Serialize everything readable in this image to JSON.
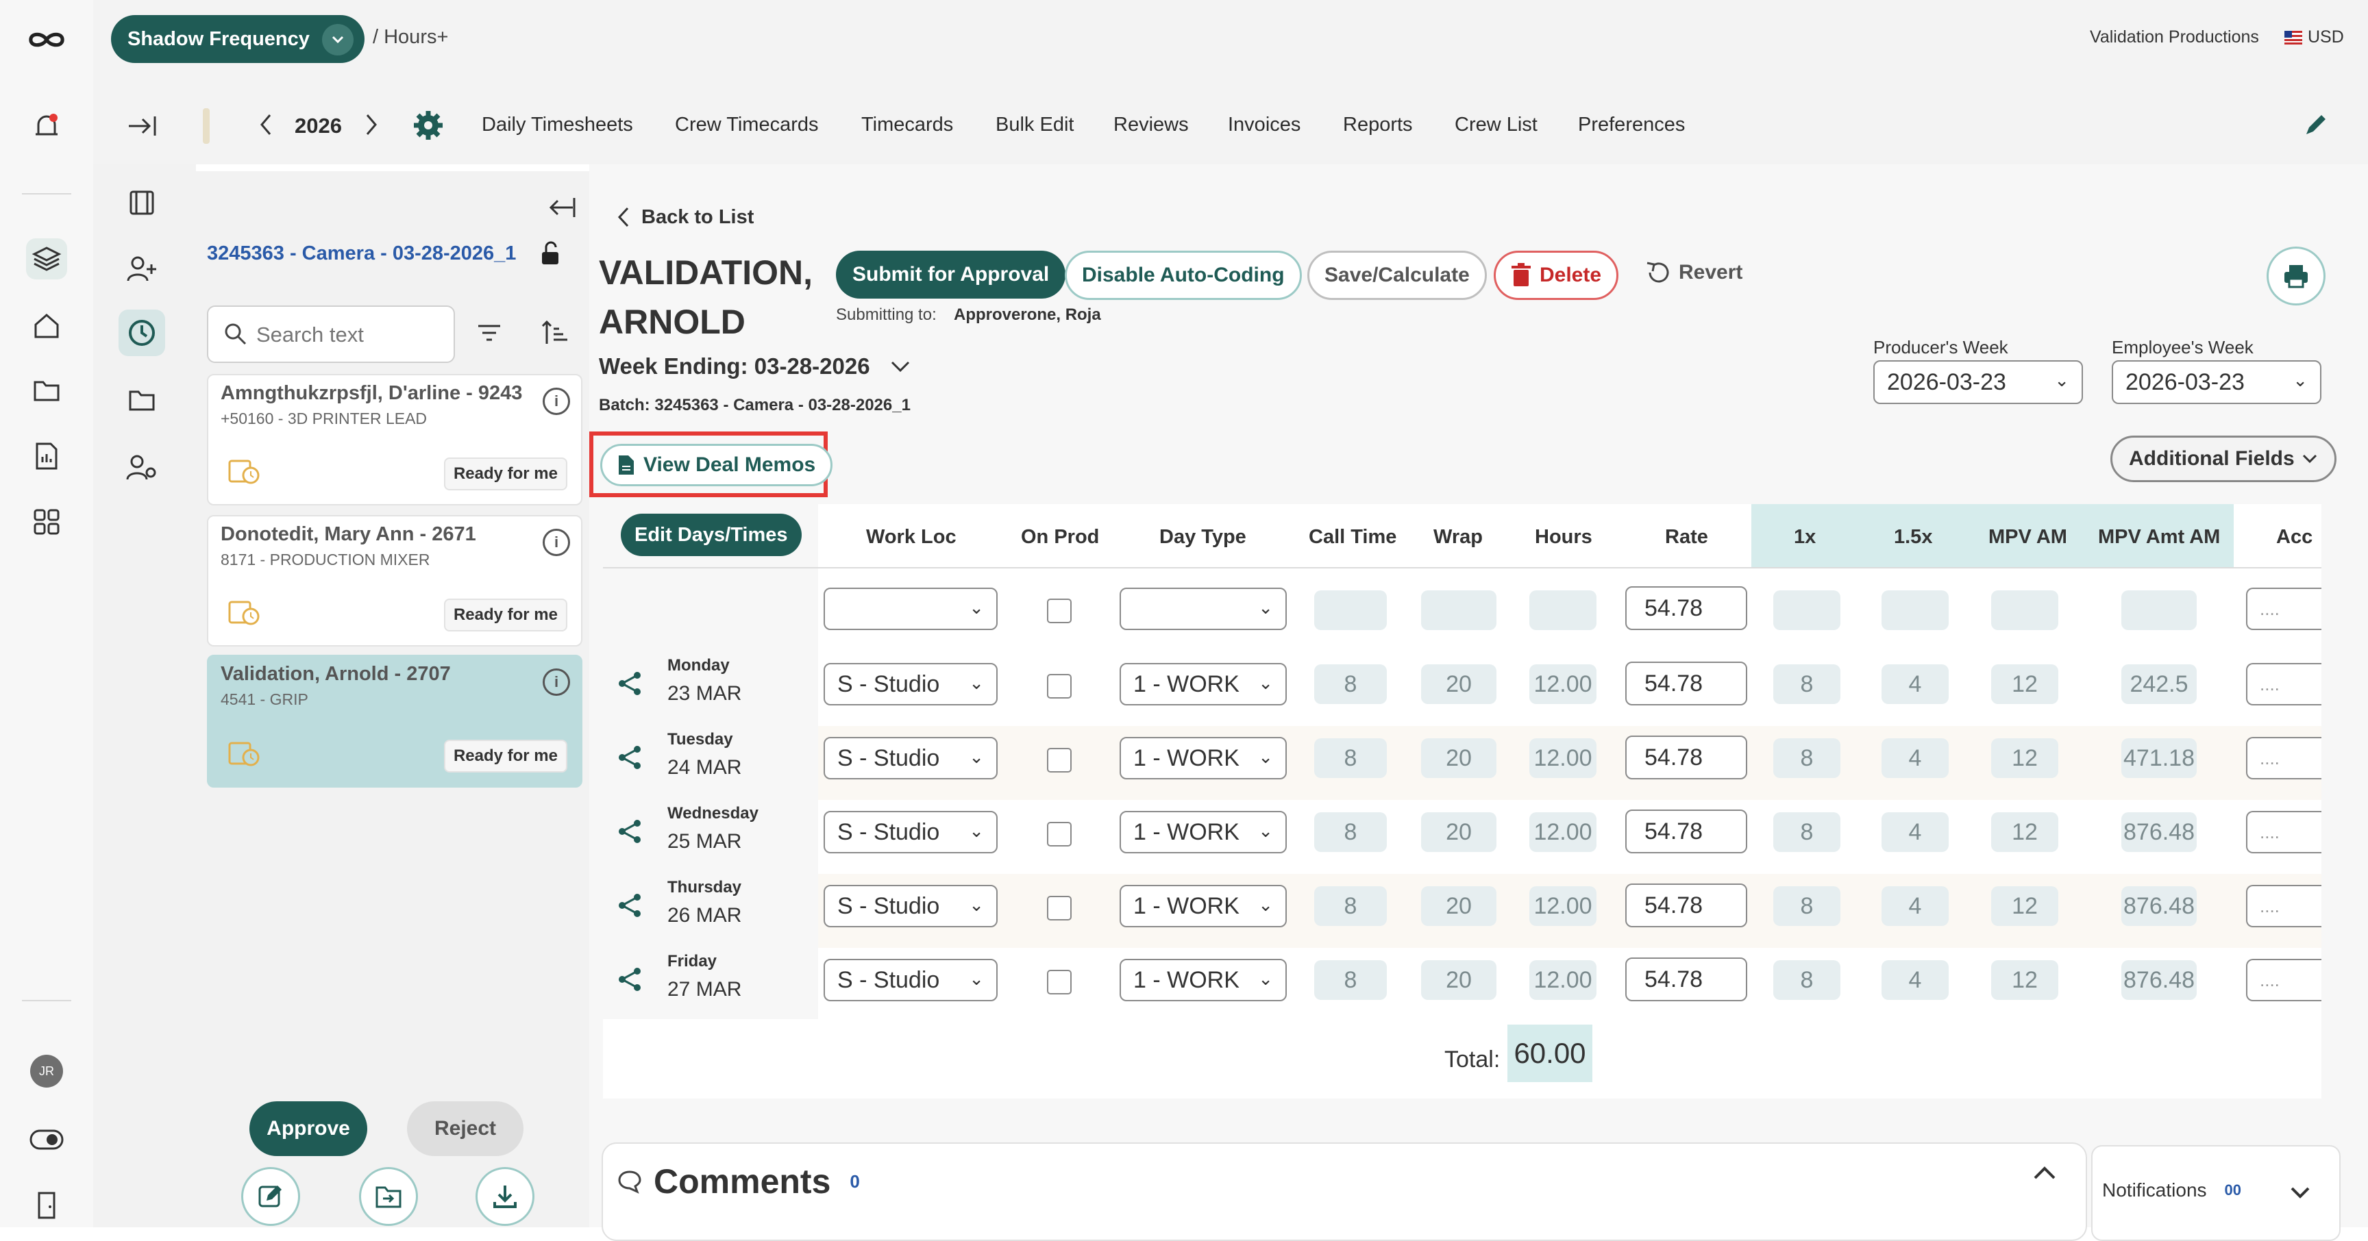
{
  "header": {
    "project": "Shadow Frequency",
    "crumb": "/ Hours+",
    "company": "Validation Productions",
    "currency": "USD"
  },
  "nav": {
    "year": "2026",
    "links": [
      "Daily Timesheets",
      "Crew Timecards",
      "Timecards",
      "Bulk Edit",
      "Reviews",
      "Invoices",
      "Reports",
      "Crew List",
      "Preferences"
    ]
  },
  "user_initials": "JR",
  "list": {
    "batch_title": "3245363 - Camera - 03-28-2026_1",
    "search_placeholder": "Search text",
    "items": [
      {
        "name": "Amngthukzrpsfjl, D'arline - 9243",
        "sub": "+50160 - 3D PRINTER LEAD",
        "status": "Ready for me"
      },
      {
        "name": "Donotedit, Mary Ann - 2671",
        "sub": "8171 - PRODUCTION MIXER",
        "status": "Ready for me"
      },
      {
        "name": "Validation, Arnold - 2707",
        "sub": "4541 - GRIP",
        "status": "Ready for me"
      }
    ],
    "approve": "Approve",
    "reject": "Reject"
  },
  "detail": {
    "back": "Back to List",
    "name_line1": "VALIDATION,",
    "name_line2": "ARNOLD",
    "submit": "Submit for Approval",
    "disable_auto": "Disable Auto-Coding",
    "save": "Save/Calculate",
    "delete": "Delete",
    "revert": "Revert",
    "submitting_label": "Submitting to:",
    "submitting_to": "Approverone, Roja",
    "week_ending": "Week Ending: 03-28-2026",
    "batch": "Batch: 3245363 - Camera - 03-28-2026_1",
    "producers_week_label": "Producer's Week",
    "producers_week": "2026-03-23",
    "employees_week_label": "Employee's Week",
    "employees_week": "2026-03-23",
    "view_deal_memos": "View Deal Memos",
    "additional_fields": "Additional Fields"
  },
  "table": {
    "edit_btn": "Edit Days/Times",
    "headers": [
      "Work Loc",
      "On Prod",
      "Day Type",
      "Call Time",
      "Wrap",
      "Hours",
      "Rate",
      "1x",
      "1.5x",
      "MPV AM",
      "MPV Amt AM",
      "Acc"
    ],
    "default_rate": "54.78",
    "acc_placeholder": "....",
    "rows": [
      {
        "dayname": "Monday",
        "date": "23 MAR",
        "loc": "S - Studio",
        "type": "1 - WORK",
        "call": "8",
        "wrap": "20",
        "hours": "12.00",
        "rate": "54.78",
        "x1": "8",
        "x15": "4",
        "mpv": "12",
        "mpvamt": "242.5"
      },
      {
        "dayname": "Tuesday",
        "date": "24 MAR",
        "loc": "S - Studio",
        "type": "1 - WORK",
        "call": "8",
        "wrap": "20",
        "hours": "12.00",
        "rate": "54.78",
        "x1": "8",
        "x15": "4",
        "mpv": "12",
        "mpvamt": "471.18"
      },
      {
        "dayname": "Wednesday",
        "date": "25 MAR",
        "loc": "S - Studio",
        "type": "1 - WORK",
        "call": "8",
        "wrap": "20",
        "hours": "12.00",
        "rate": "54.78",
        "x1": "8",
        "x15": "4",
        "mpv": "12",
        "mpvamt": "876.48"
      },
      {
        "dayname": "Thursday",
        "date": "26 MAR",
        "loc": "S - Studio",
        "type": "1 - WORK",
        "call": "8",
        "wrap": "20",
        "hours": "12.00",
        "rate": "54.78",
        "x1": "8",
        "x15": "4",
        "mpv": "12",
        "mpvamt": "876.48"
      },
      {
        "dayname": "Friday",
        "date": "27 MAR",
        "loc": "S - Studio",
        "type": "1 - WORK",
        "call": "8",
        "wrap": "20",
        "hours": "12.00",
        "rate": "54.78",
        "x1": "8",
        "x15": "4",
        "mpv": "12",
        "mpvamt": "876.48"
      }
    ],
    "total_label": "Total:",
    "total_value": "60.00"
  },
  "comments": {
    "title": "Comments",
    "count": "0"
  },
  "notifications": {
    "title": "Notifications",
    "count": "00"
  }
}
